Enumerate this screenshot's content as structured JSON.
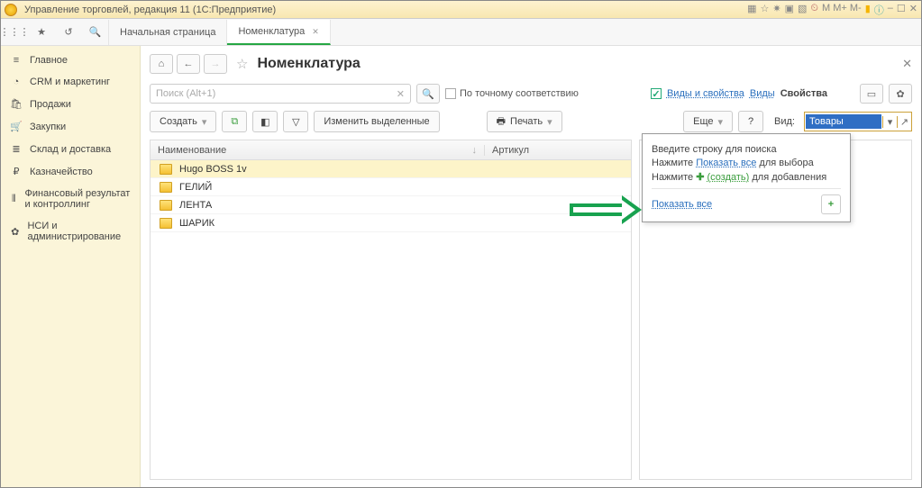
{
  "titlebar": {
    "title": "Управление торговлей, редакция 11  (1С:Предприятие)"
  },
  "tabs": {
    "home": "Начальная страница",
    "active": "Номенклатура"
  },
  "sidebar": {
    "items": [
      {
        "icon": "≡",
        "label": "Главное"
      },
      {
        "icon": "◔",
        "label": "CRM и маркетинг"
      },
      {
        "icon": "🛍",
        "label": "Продажи"
      },
      {
        "icon": "🛒",
        "label": "Закупки"
      },
      {
        "icon": "≣",
        "label": "Склад и доставка"
      },
      {
        "icon": "₽",
        "label": "Казначейство"
      },
      {
        "icon": "⫴",
        "label": "Финансовый результат и контроллинг"
      },
      {
        "icon": "✿",
        "label": "НСИ и администрирование"
      }
    ]
  },
  "page": {
    "title": "Номенклатура"
  },
  "search": {
    "placeholder": "Поиск (Alt+1)",
    "exact_label": "По точному соответствию"
  },
  "filter": {
    "link1": "Виды и свойства",
    "link2": "Виды",
    "bold": "Свойства"
  },
  "toolbar": {
    "create": "Создать",
    "change_sel": "Изменить выделенные",
    "print": "Печать",
    "more": "Еще",
    "kind_label": "Вид:",
    "kind_value": "Товары"
  },
  "table": {
    "columns": {
      "name": "Наименование",
      "article": "Артикул",
      "sort": "↓"
    },
    "rows": [
      {
        "name": "Hugo BOSS 1v"
      },
      {
        "name": "ГЕЛИЙ"
      },
      {
        "name": "ЛЕНТА"
      },
      {
        "name": "ШАРИК"
      }
    ]
  },
  "dropdown": {
    "hint1": "Введите строку для поиска",
    "hint2_pre": "Нажмите ",
    "hint2_link": "Показать все",
    "hint2_post": " для выбора",
    "hint3_pre": "Нажмите ",
    "hint3_link": "(создать)",
    "hint3_post": " для добавления",
    "show_all": "Показать все"
  }
}
